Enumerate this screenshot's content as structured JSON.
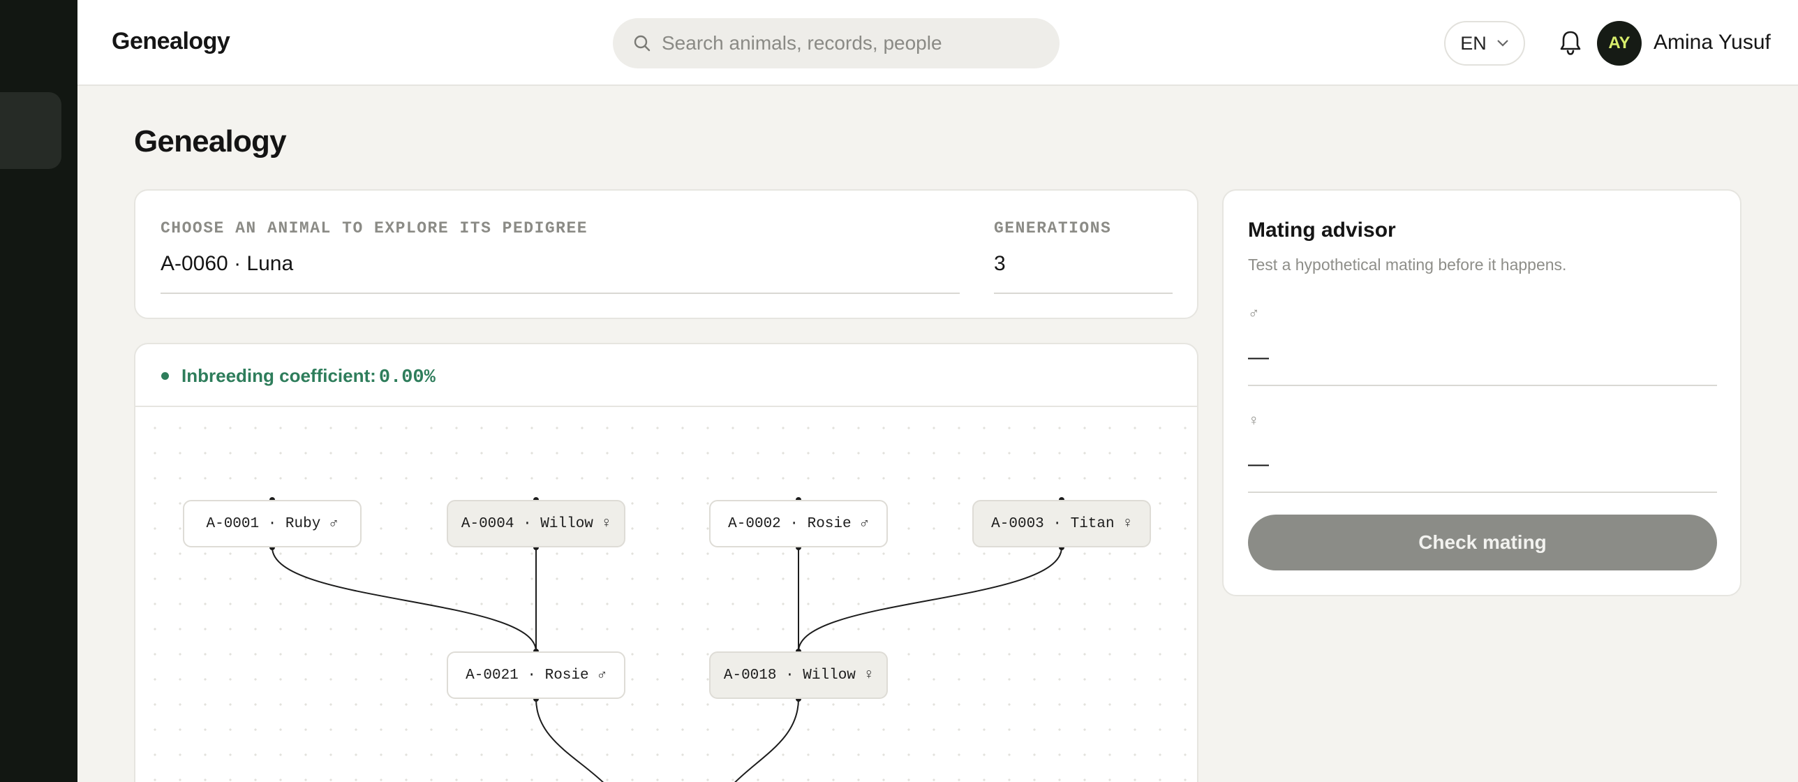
{
  "header": {
    "app_title": "Genealogy",
    "search_placeholder": "Search animals, records, people",
    "language": "EN",
    "user": {
      "initials": "AY",
      "name": "Amina Yusuf"
    }
  },
  "page": {
    "title": "Genealogy"
  },
  "selector": {
    "animal_label": "CHOOSE AN ANIMAL TO EXPLORE ITS PEDIGREE",
    "animal_value": "A-0060 · Luna",
    "generations_label": "GENERATIONS",
    "generations_value": "3"
  },
  "pedigree": {
    "coefficient_label": "Inbreeding coefficient:",
    "coefficient_value": "0.00%",
    "nodes": [
      {
        "label": "A-0001 · Ruby ♂",
        "sex": "male"
      },
      {
        "label": "A-0004 · Willow ♀",
        "sex": "female"
      },
      {
        "label": "A-0002 · Rosie ♂",
        "sex": "male"
      },
      {
        "label": "A-0003 · Titan ♀",
        "sex": "female"
      },
      {
        "label": "A-0021 · Rosie ♂",
        "sex": "male"
      },
      {
        "label": "A-0018 · Willow ♀",
        "sex": "female"
      }
    ]
  },
  "advisor": {
    "title": "Mating advisor",
    "subtitle": "Test a hypothetical mating before it happens.",
    "male_symbol": "♂",
    "male_value": "—",
    "female_symbol": "♀",
    "female_value": "—",
    "button_label": "Check mating"
  },
  "colors": {
    "sidebar": "#121712",
    "accent_green": "#2e7d5b",
    "avatar_text": "#d8ee6c",
    "button_disabled": "#8b8c87"
  }
}
